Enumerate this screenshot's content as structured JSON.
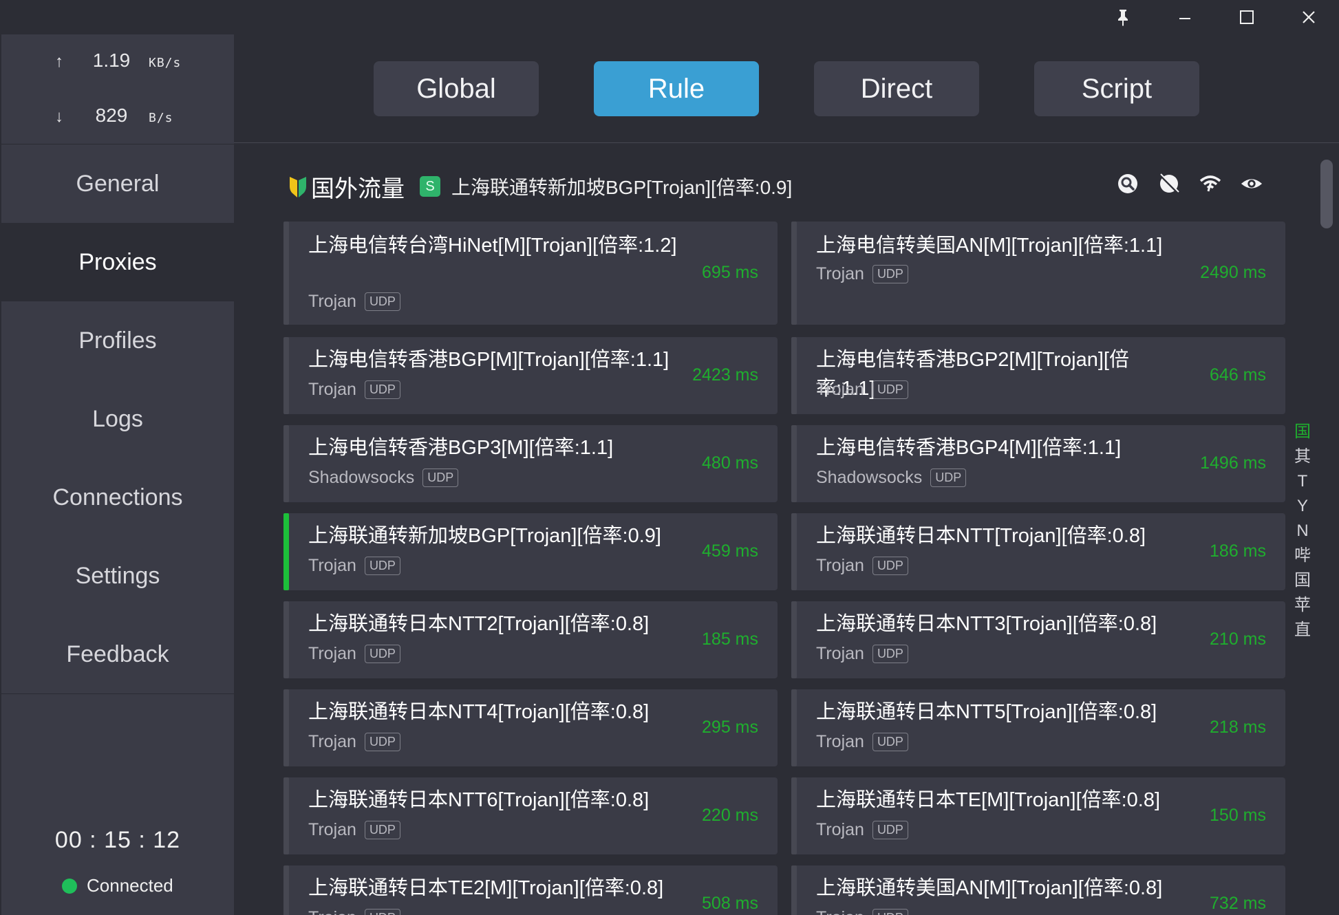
{
  "titlebar": {
    "controls": [
      {
        "id": "pin",
        "icon": "pin-icon"
      },
      {
        "id": "minimize",
        "icon": "minimize-icon"
      },
      {
        "id": "maximize",
        "icon": "maximize-icon"
      },
      {
        "id": "close",
        "icon": "close-icon"
      }
    ]
  },
  "traffic": {
    "up": {
      "arrow": "↑",
      "value": "1.19",
      "unit": "KB/s"
    },
    "down": {
      "arrow": "↓",
      "value": "829",
      "unit": "B/s"
    }
  },
  "nav": [
    "General",
    "Proxies",
    "Profiles",
    "Logs",
    "Connections",
    "Settings",
    "Feedback"
  ],
  "nav_active": "Proxies",
  "timer": "00 : 15 : 12",
  "status": {
    "label": "Connected",
    "color": "#1fbf5a"
  },
  "modes": [
    {
      "label": "Global",
      "active": false
    },
    {
      "label": "Rule",
      "active": true
    },
    {
      "label": "Direct",
      "active": false
    },
    {
      "label": "Script",
      "active": false
    }
  ],
  "group": {
    "name": "国外流量",
    "badge": "S",
    "current": "上海联通转新加坡BGP[Trojan][倍率:0.9]",
    "tools": [
      "search-location-icon",
      "location-off-icon",
      "wifi-speed-icon",
      "eye-icon"
    ]
  },
  "proxies": [
    {
      "name": "上海电信转台湾HiNet[M][Trojan][倍率:1.2]",
      "type": "Trojan",
      "udp": "UDP",
      "delay": "695 ms"
    },
    {
      "name": "上海电信转美国AN[M][Trojan][倍率:1.1]",
      "type": "Trojan",
      "udp": "UDP",
      "delay": "2490 ms"
    },
    {
      "name": "上海电信转香港BGP[M][Trojan][倍率:1.1]",
      "type": "Trojan",
      "udp": "UDP",
      "delay": "2423 ms"
    },
    {
      "name": "上海电信转香港BGP2[M][Trojan][倍率:1.1]",
      "type": "Trojan",
      "udp": "UDP",
      "delay": "646 ms"
    },
    {
      "name": "上海电信转香港BGP3[M][倍率:1.1]",
      "type": "Shadowsocks",
      "udp": "UDP",
      "delay": "480 ms"
    },
    {
      "name": "上海电信转香港BGP4[M][倍率:1.1]",
      "type": "Shadowsocks",
      "udp": "UDP",
      "delay": "1496 ms"
    },
    {
      "name": "上海联通转新加坡BGP[Trojan][倍率:0.9]",
      "type": "Trojan",
      "udp": "UDP",
      "delay": "459 ms",
      "selected": true
    },
    {
      "name": "上海联通转日本NTT[Trojan][倍率:0.8]",
      "type": "Trojan",
      "udp": "UDP",
      "delay": "186 ms"
    },
    {
      "name": "上海联通转日本NTT2[Trojan][倍率:0.8]",
      "type": "Trojan",
      "udp": "UDP",
      "delay": "185 ms"
    },
    {
      "name": "上海联通转日本NTT3[Trojan][倍率:0.8]",
      "type": "Trojan",
      "udp": "UDP",
      "delay": "210 ms"
    },
    {
      "name": "上海联通转日本NTT4[Trojan][倍率:0.8]",
      "type": "Trojan",
      "udp": "UDP",
      "delay": "295 ms"
    },
    {
      "name": "上海联通转日本NTT5[Trojan][倍率:0.8]",
      "type": "Trojan",
      "udp": "UDP",
      "delay": "218 ms"
    },
    {
      "name": "上海联通转日本NTT6[Trojan][倍率:0.8]",
      "type": "Trojan",
      "udp": "UDP",
      "delay": "220 ms"
    },
    {
      "name": "上海联通转日本TE[M][Trojan][倍率:0.8]",
      "type": "Trojan",
      "udp": "UDP",
      "delay": "150 ms"
    },
    {
      "name": "上海联通转日本TE2[M][Trojan][倍率:0.8]",
      "type": "Trojan",
      "udp": "UDP",
      "delay": "508 ms"
    },
    {
      "name": "上海联通转美国AN[M][Trojan][倍率:0.8]",
      "type": "Trojan",
      "udp": "UDP",
      "delay": "732 ms"
    }
  ],
  "index": [
    "国",
    "其",
    "T",
    "Y",
    "N",
    "哔",
    "国",
    "苹",
    "直"
  ],
  "colors": {
    "accent": "#3a9fd3",
    "delay": "#1fae2e",
    "selected": "#1dbf3a"
  }
}
